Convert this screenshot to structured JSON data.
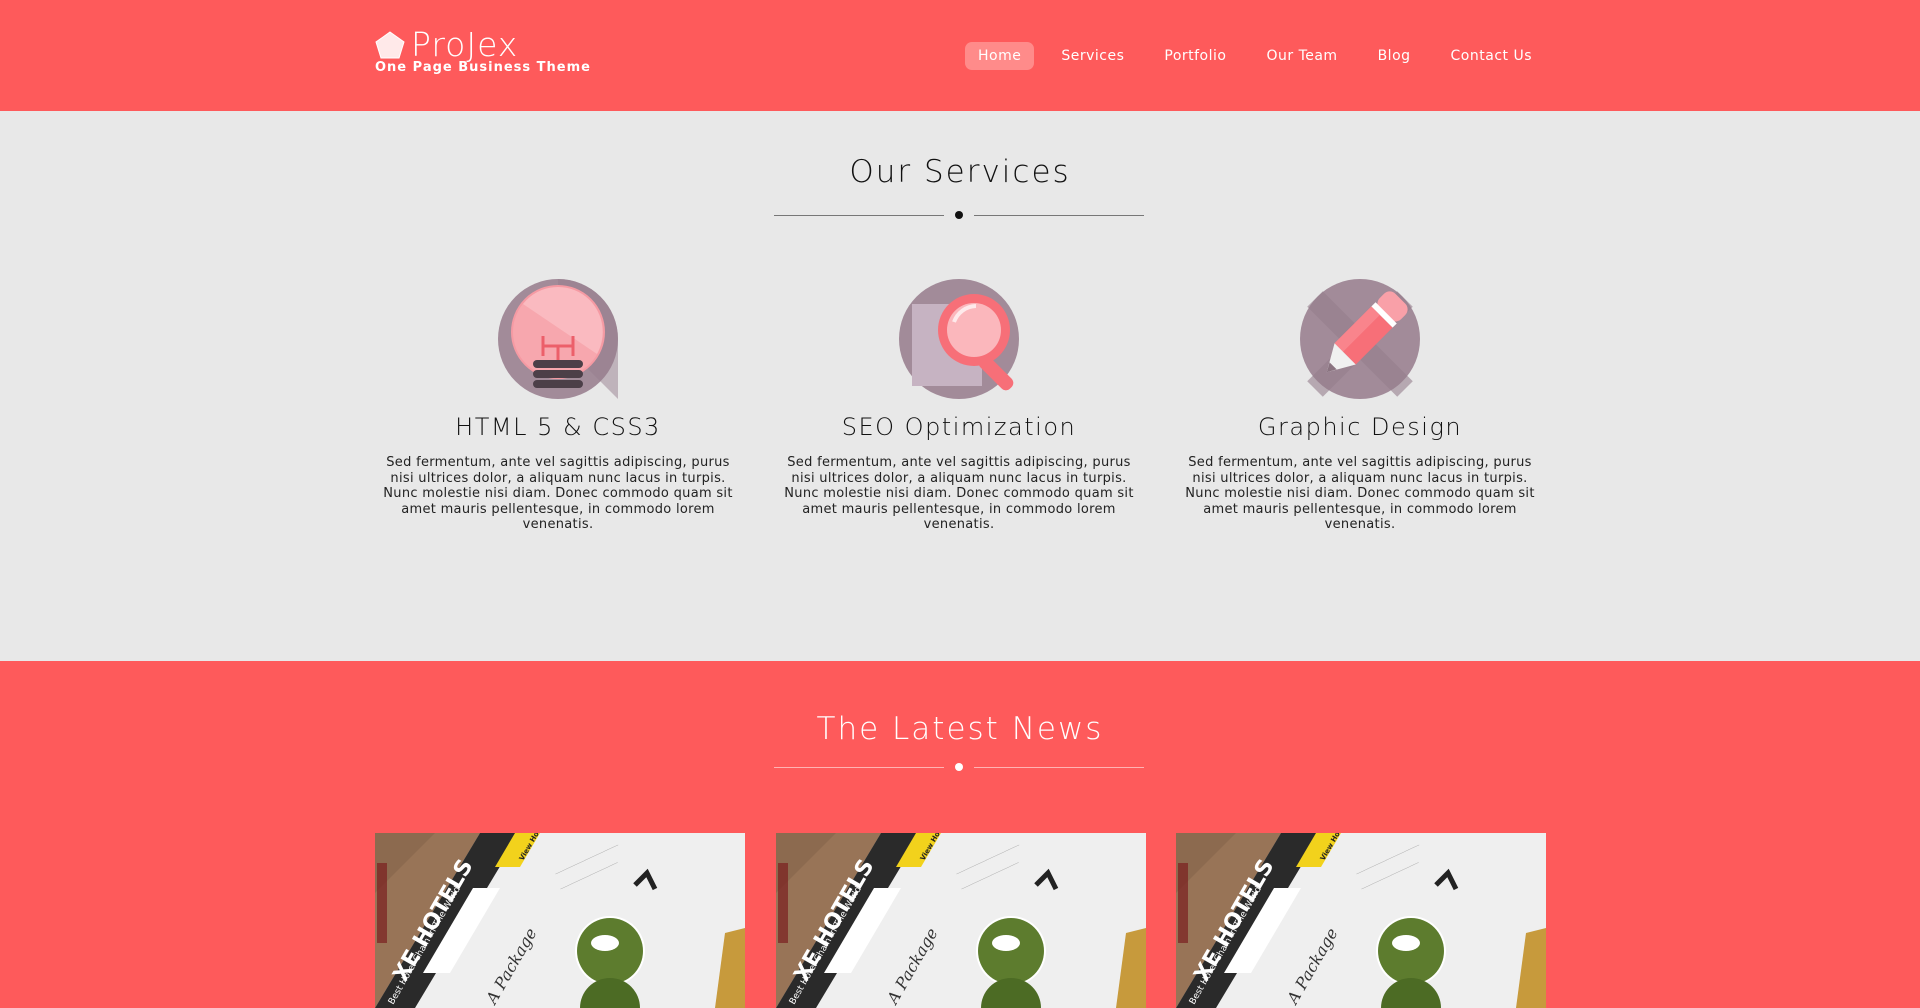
{
  "brand": {
    "name": "ProJex",
    "tagline": "One Page Business Theme"
  },
  "nav": {
    "items": [
      {
        "label": "Home",
        "active": true
      },
      {
        "label": "Services",
        "active": false
      },
      {
        "label": "Portfolio",
        "active": false
      },
      {
        "label": "Our Team",
        "active": false
      },
      {
        "label": "Blog",
        "active": false
      },
      {
        "label": "Contact Us",
        "active": false
      }
    ]
  },
  "services": {
    "title": "Our Services",
    "items": [
      {
        "icon": "lightbulb-icon",
        "title": "HTML 5 & CSS3",
        "text": "Sed fermentum, ante vel sagittis adipiscing, purus nisi ultrices dolor, a aliquam nunc lacus in turpis. Nunc molestie nisi diam. Donec commodo quam sit amet mauris pellentesque, in commodo lorem venenatis."
      },
      {
        "icon": "magnifier-icon",
        "title": "SEO Optimization",
        "text": "Sed fermentum, ante vel sagittis adipiscing, purus nisi ultrices dolor, a aliquam nunc lacus in turpis. Nunc molestie nisi diam. Donec commodo quam sit amet mauris pellentesque, in commodo lorem venenatis."
      },
      {
        "icon": "pencil-icon",
        "title": "Graphic Design",
        "text": "Sed fermentum, ante vel sagittis adipiscing, purus nisi ultrices dolor, a aliquam nunc lacus in turpis. Nunc molestie nisi diam. Donec commodo quam sit amet mauris pellentesque, in commodo lorem venenatis."
      }
    ]
  },
  "news": {
    "title": "The Latest News",
    "cards": [
      {
        "headline": "XE HOTELS",
        "subline": "Best Hotel Chain In The World",
        "badge": "View Hotels",
        "script": "A Package"
      },
      {
        "headline": "XE HOTELS",
        "subline": "Best Hotel Chain In The World",
        "badge": "View Hotels",
        "script": "A Package"
      },
      {
        "headline": "XE HOTELS",
        "subline": "Best Hotel Chain In The World",
        "badge": "View Hotels",
        "script": "A Package"
      }
    ]
  },
  "colors": {
    "brand_red": "#fe5a5b",
    "active_nav_bg": "#ff8b8a",
    "section_bg": "#e8e8e8",
    "icon_circle": "#a28b99",
    "icon_pink": "#f76f78"
  }
}
